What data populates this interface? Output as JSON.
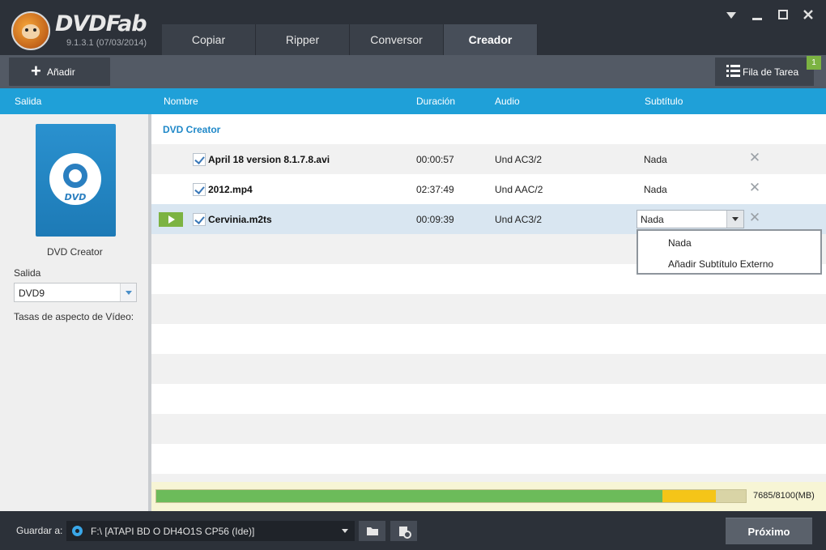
{
  "app": {
    "brand": "DVDFab",
    "version": "9.1.3.1 (07/03/2014)",
    "tabs": [
      {
        "label": "Copiar"
      },
      {
        "label": "Ripper"
      },
      {
        "label": "Conversor"
      },
      {
        "label": "Creador"
      }
    ],
    "active_tab": "Creador"
  },
  "toolbar": {
    "add_label": "Añadir",
    "queue_label": "Fila de Tarea",
    "queue_count": "1"
  },
  "header": {
    "salida": "Salida",
    "nombre": "Nombre",
    "duracion": "Duración",
    "audio": "Audio",
    "subtitulo": "Subtítulo"
  },
  "left": {
    "dvd_icon_text": "DVD",
    "profile_name": "DVD Creator",
    "output_label": "Salida",
    "output_value": "DVD9",
    "aspect_label": "Tasas de aspecto de Vídeo:"
  },
  "list": {
    "group": "DVD Creator",
    "files": [
      {
        "name": "April 18 version 8.1.7.8.avi",
        "duration": "00:00:57",
        "audio": "Und AC3/2",
        "subtitle": "Nada"
      },
      {
        "name": "2012.mp4",
        "duration": "02:37:49",
        "audio": "Und AAC/2",
        "subtitle": "Nada"
      },
      {
        "name": "Cervinia.m2ts",
        "duration": "00:09:39",
        "audio": "Und AC3/2",
        "subtitle": "Nada"
      }
    ],
    "dropdown_options": [
      "Nada",
      "Añadir Subtítulo Externo"
    ]
  },
  "capacity": {
    "text": "7685/8100(MB)",
    "used_mb": 7685,
    "total_mb": 8100
  },
  "bottom": {
    "save_label": "Guardar a:",
    "path": "F:\\ [ATAPI BD  O  DH4O1S CP56 (Ide)]",
    "next_label": "Próximo"
  },
  "colors": {
    "accent": "#1fa0d8",
    "play": "#7cb342",
    "capacity_fill": "#6cbb5a",
    "capacity_warn": "#f5c518"
  }
}
